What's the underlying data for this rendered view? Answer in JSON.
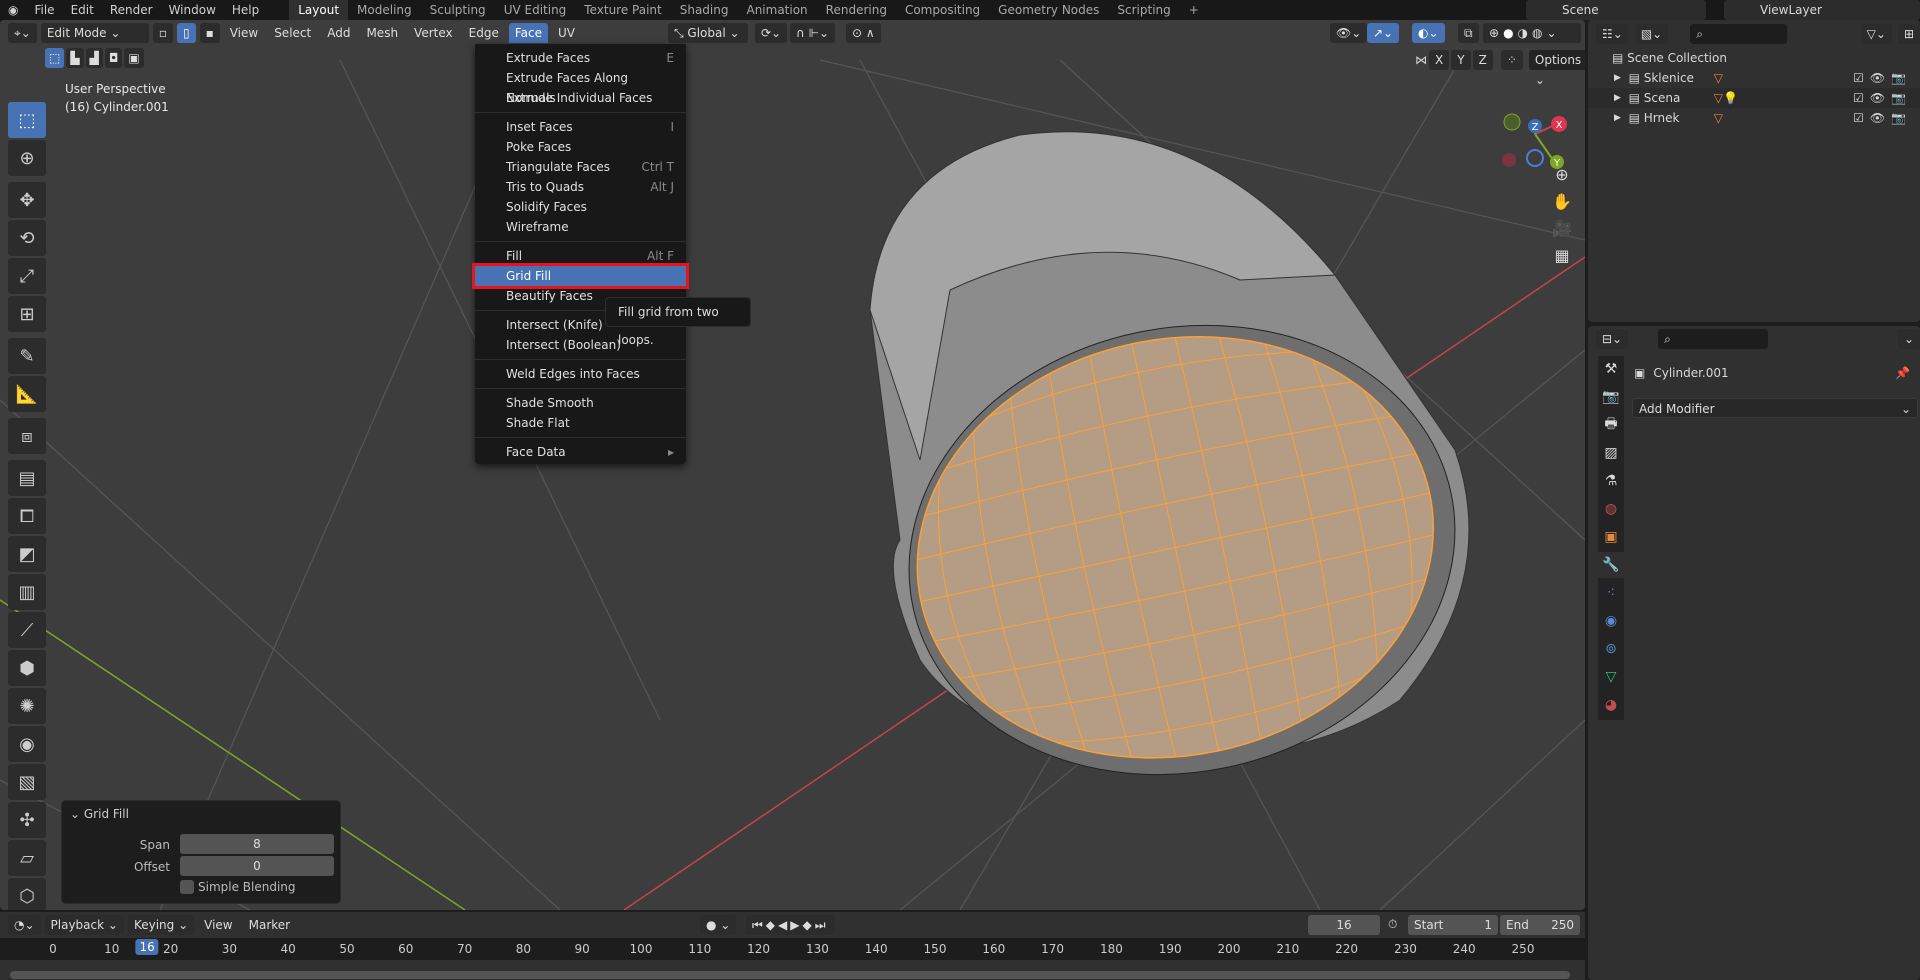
{
  "topbar": {
    "menus": [
      "File",
      "Edit",
      "Render",
      "Window",
      "Help"
    ],
    "workspaces": [
      "Layout",
      "Modeling",
      "Sculpting",
      "UV Editing",
      "Texture Paint",
      "Shading",
      "Animation",
      "Rendering",
      "Compositing",
      "Geometry Nodes",
      "Scripting"
    ],
    "active_workspace": "Layout",
    "add_workspace": "+",
    "scene": "Scene",
    "view_layer": "ViewLayer"
  },
  "viewport": {
    "mode": "Edit Mode",
    "menus": [
      "View",
      "Select",
      "Add",
      "Mesh",
      "Vertex",
      "Edge",
      "Face",
      "UV"
    ],
    "open_menu": "Face",
    "orientation": "Global",
    "options": "Options",
    "axes": [
      "X",
      "Y",
      "Z"
    ],
    "overlay_text": {
      "view": "User Perspective",
      "object": "(16) Cylinder.001"
    },
    "gizmo": {
      "x": "X",
      "y": "Y",
      "z": "Z"
    }
  },
  "face_menu": {
    "groups": [
      [
        {
          "label": "Extrude Faces",
          "shortcut": "E"
        },
        {
          "label": "Extrude Faces Along Normals",
          "shortcut": ""
        },
        {
          "label": "Extrude Individual Faces",
          "shortcut": ""
        }
      ],
      [
        {
          "label": "Inset Faces",
          "shortcut": "I"
        },
        {
          "label": "Poke Faces",
          "shortcut": ""
        },
        {
          "label": "Triangulate Faces",
          "shortcut": "Ctrl T"
        },
        {
          "label": "Tris to Quads",
          "shortcut": "Alt J"
        },
        {
          "label": "Solidify Faces",
          "shortcut": ""
        },
        {
          "label": "Wireframe",
          "shortcut": ""
        }
      ],
      [
        {
          "label": "Fill",
          "shortcut": "Alt F"
        },
        {
          "label": "Grid Fill",
          "shortcut": "",
          "highlighted": true
        },
        {
          "label": "Beautify Faces",
          "shortcut": ""
        }
      ],
      [
        {
          "label": "Intersect (Knife)",
          "shortcut": ""
        },
        {
          "label": "Intersect (Boolean)",
          "shortcut": ""
        }
      ],
      [
        {
          "label": "Weld Edges into Faces",
          "shortcut": ""
        }
      ],
      [
        {
          "label": "Shade Smooth",
          "shortcut": ""
        },
        {
          "label": "Shade Flat",
          "shortcut": ""
        }
      ],
      [
        {
          "label": "Face Data",
          "shortcut": "",
          "submenu": true
        }
      ]
    ],
    "tooltip": "Fill grid from two loops."
  },
  "operator_panel": {
    "title": "Grid Fill",
    "span_label": "Span",
    "span": "8",
    "offset_label": "Offset",
    "offset": "0",
    "simple_blending_label": "Simple Blending",
    "simple_blending": false
  },
  "timeline": {
    "menus": [
      "Playback",
      "Keying",
      "View",
      "Marker"
    ],
    "current_frame": "16",
    "start_label": "Start",
    "start": "1",
    "end_label": "End",
    "end": "250",
    "ticks": [
      "0",
      "10",
      "20",
      "30",
      "40",
      "50",
      "60",
      "70",
      "80",
      "90",
      "100",
      "110",
      "120",
      "130",
      "140",
      "150",
      "160",
      "170",
      "180",
      "190",
      "200",
      "210",
      "220",
      "230",
      "240",
      "250"
    ]
  },
  "outliner": {
    "root": "Scene Collection",
    "collections": [
      {
        "name": "Sklenice"
      },
      {
        "name": "Scena"
      },
      {
        "name": "Hrnek"
      }
    ]
  },
  "properties": {
    "object": "Cylinder.001",
    "add_modifier": "Add Modifier",
    "active_tab": "modifier"
  },
  "colors": {
    "accent": "#4772b3",
    "selection": "#ffa033",
    "highlight_border": "#e8141c",
    "x_axis": "#c8424f",
    "y_axis": "#7da625"
  }
}
